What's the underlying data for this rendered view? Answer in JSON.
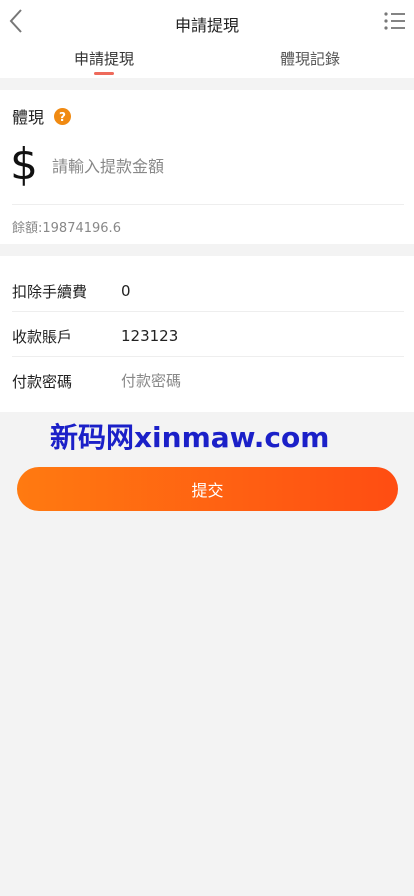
{
  "header": {
    "title": "申請提現",
    "back_icon": "chevron-left-icon",
    "menu_icon": "list-icon"
  },
  "tabs": [
    {
      "label": "申請提現",
      "active": true
    },
    {
      "label": "體現記錄",
      "active": false
    }
  ],
  "withdraw": {
    "section_title": "體現",
    "help_icon_text": "?",
    "currency_symbol": "$",
    "amount_placeholder": "請輸入提款金額",
    "balance_label": "餘額:",
    "balance_value": "19874196.6"
  },
  "details": [
    {
      "label": "扣除手續費",
      "value": "0"
    },
    {
      "label": "收款賬戶",
      "value": "123123"
    },
    {
      "label": "付款密碼",
      "placeholder": "付款密碼"
    }
  ],
  "watermark": "新码网xinmaw.com",
  "submit_label": "提交",
  "colors": {
    "accent": "#ff5a12",
    "accent_start": "#ff7a11",
    "help_icon": "#f08a12",
    "tab_indicator": "#ee6a5b",
    "watermark": "#1b20c8",
    "background": "#f3f3f3"
  }
}
